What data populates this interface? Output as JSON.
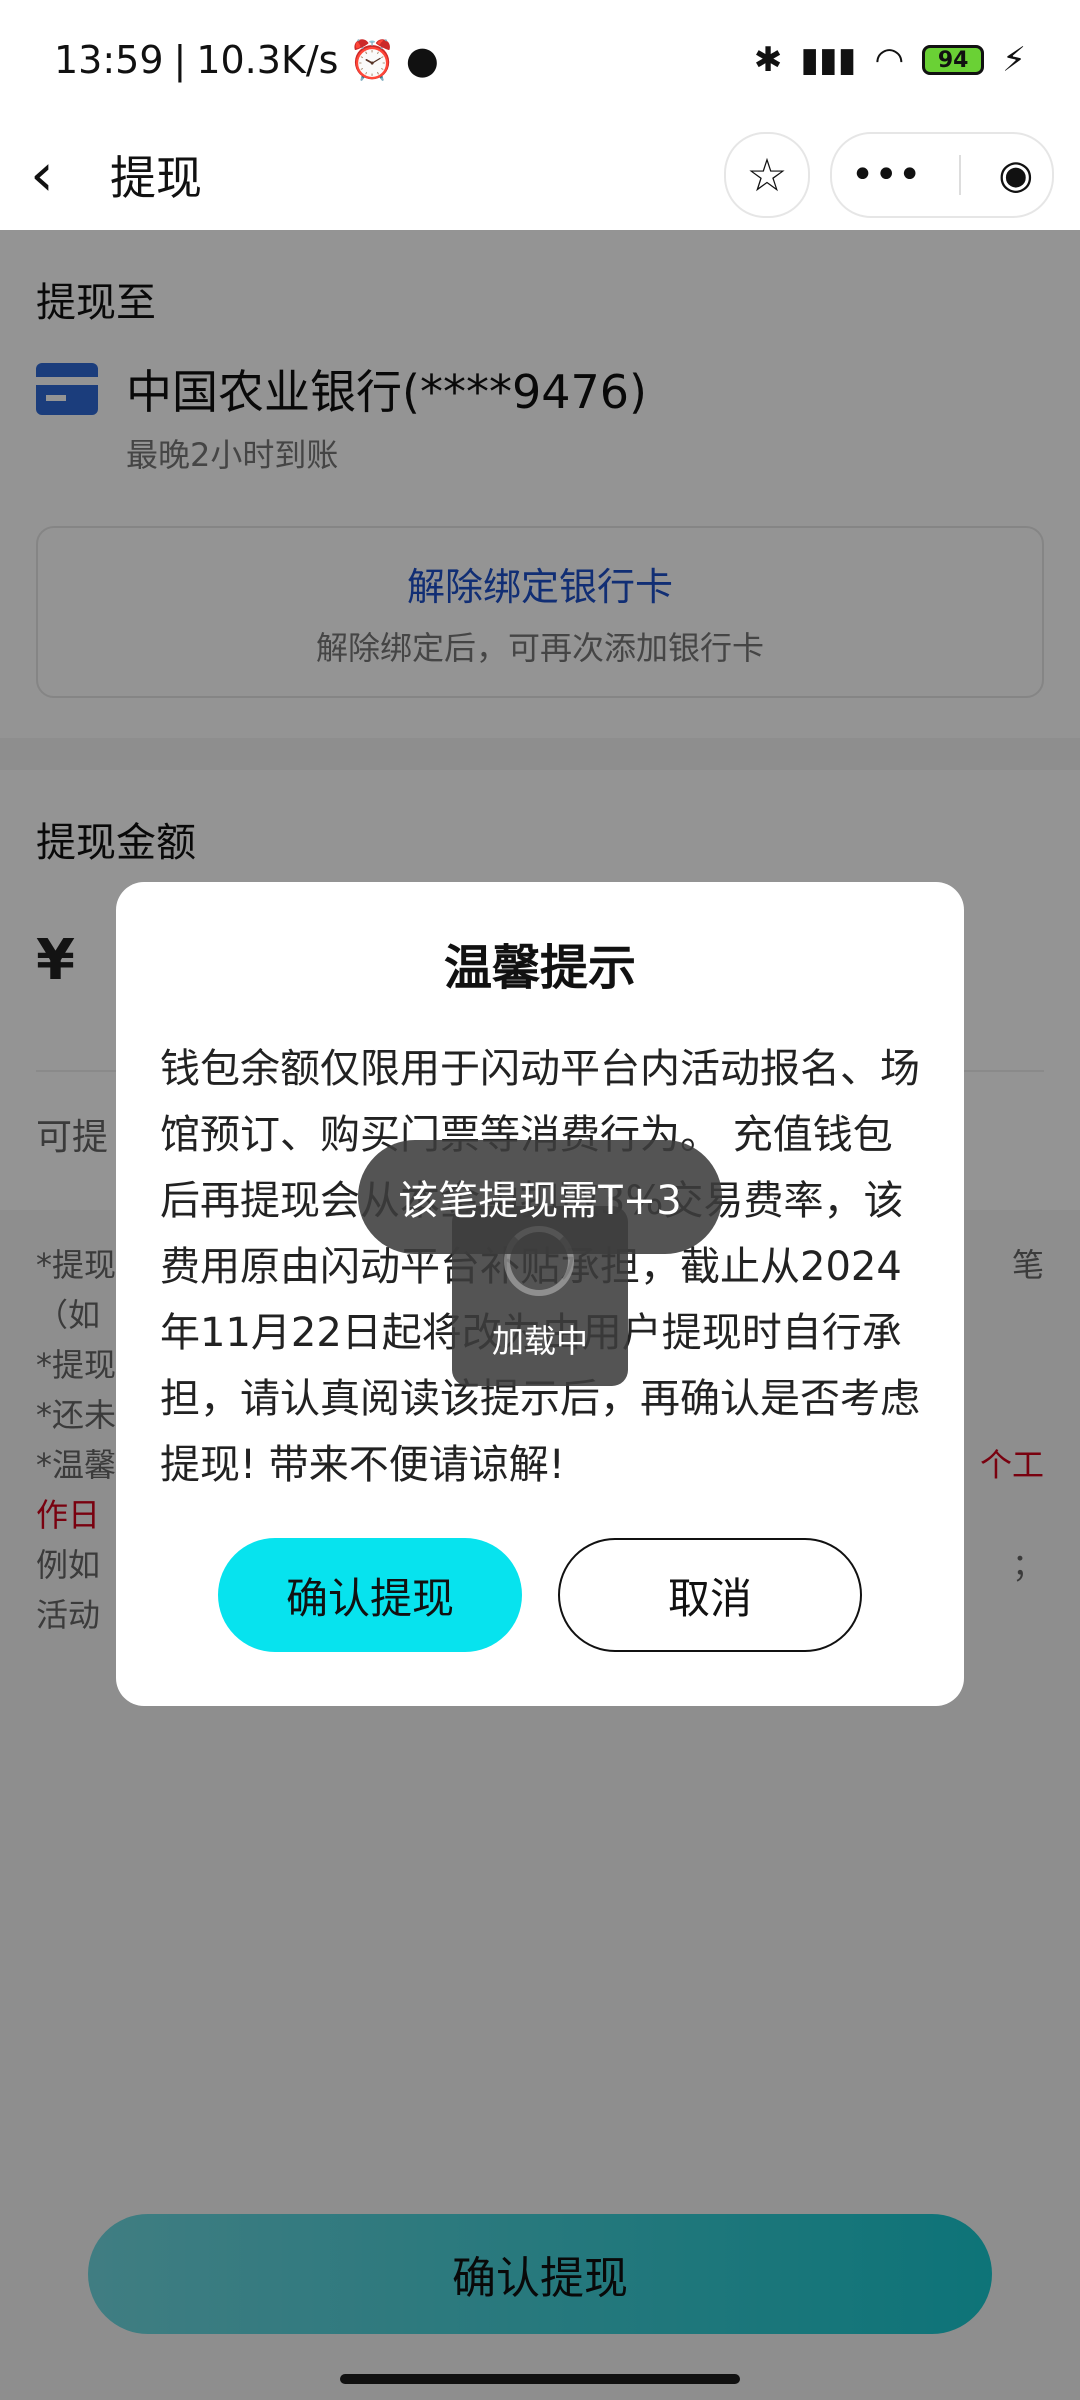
{
  "status": {
    "time": "13:59",
    "speed": "10.3K/s",
    "battery": "94"
  },
  "nav": {
    "title": "提现"
  },
  "withdraw_to": {
    "title": "提现至",
    "bank_name": "中国农业银行(****9476)",
    "arrival_note": "最晚2小时到账",
    "unbind_title": "解除绑定银行卡",
    "unbind_sub": "解除绑定后，可再次添加银行卡"
  },
  "amount": {
    "title": "提现金额",
    "currency": "¥",
    "available_prefix": "可提"
  },
  "notes": {
    "line1": "*提现",
    "line1_end": "笔",
    "line2": "（如",
    "line3": "*提现",
    "line4": "*还未",
    "line5": "*温馨",
    "line5_end": "个工",
    "line6": "作日",
    "line7": "例如",
    "line7_end": "；",
    "line8": "活动"
  },
  "bottom_button": "确认提现",
  "modal": {
    "title": "温馨提示",
    "body": "钱包余额仅限用于闪动平台内活动报名、场馆预订、购买门票等消费行为。 充值钱包后再提现会从本金中扣取3%交易费率，该费用原由闪动平台补贴承担，截止从2024年11月22日起将改为由用户提现时自行承担，请认真阅读该提示后，再确认是否考虑提现! 带来不便请谅解!",
    "confirm": "确认提现",
    "cancel": "取消"
  },
  "toast": "该笔提现需T+3",
  "loading": "加载中"
}
